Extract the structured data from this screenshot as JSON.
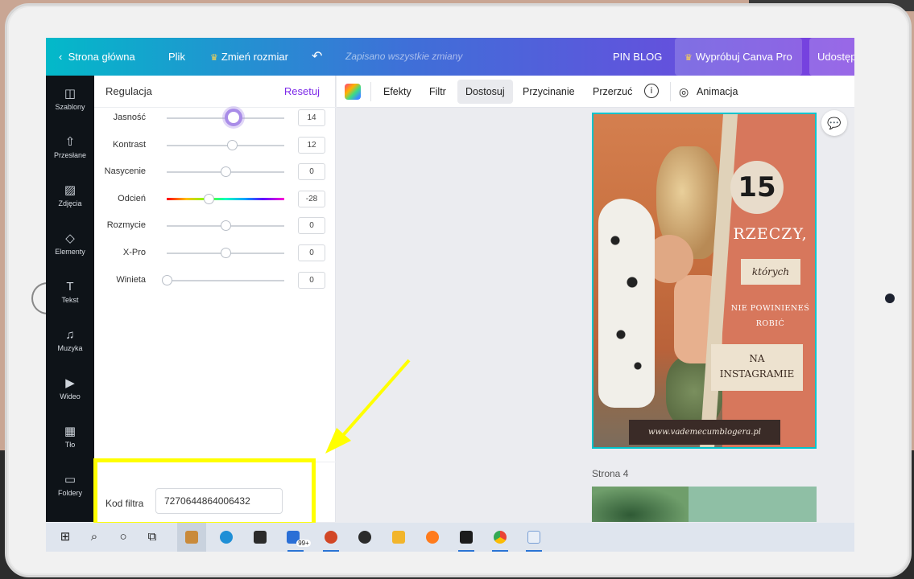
{
  "topbar": {
    "back": "Strona główna",
    "file": "Plik",
    "resize": "Zmień rozmiar",
    "undo_icon": "↶",
    "saved": "Zapisano wszystkie zmiany",
    "project": "PIN BLOG",
    "try_pro": "Wypróbuj Canva Pro",
    "share": "Udostęp",
    "crown_icon": "♛"
  },
  "sidebar": {
    "items": [
      {
        "label": "Szablony",
        "icon": "◫"
      },
      {
        "label": "Przesłane",
        "icon": "⇧"
      },
      {
        "label": "Zdjęcia",
        "icon": "▨"
      },
      {
        "label": "Elementy",
        "icon": "◇"
      },
      {
        "label": "Tekst",
        "icon": "T"
      },
      {
        "label": "Muzyka",
        "icon": "♫"
      },
      {
        "label": "Wideo",
        "icon": "▶"
      },
      {
        "label": "Tło",
        "icon": "▦"
      },
      {
        "label": "Foldery",
        "icon": "▭"
      }
    ]
  },
  "panel": {
    "title": "Regulacja",
    "reset": "Resetuj",
    "adjustments": [
      {
        "label": "Jasność",
        "value": "14",
        "level": 0.57
      },
      {
        "label": "Kontrast",
        "value": "12",
        "level": 0.56
      },
      {
        "label": "Nasycenie",
        "value": "0",
        "level": 0.5
      },
      {
        "label": "Odcień",
        "value": "-28",
        "level": 0.36
      },
      {
        "label": "Rozmycie",
        "value": "0",
        "level": 0.5
      },
      {
        "label": "X-Pro",
        "value": "0",
        "level": 0.5
      },
      {
        "label": "Winieta",
        "value": "0",
        "level": 0.0
      }
    ],
    "filter_label": "Kod filtra",
    "filter_code": "7270644864006432"
  },
  "context_toolbar": {
    "effects": "Efekty",
    "filter": "Filtr",
    "adjust": "Dostosuj",
    "crop": "Przycinanie",
    "flip": "Przerzuć",
    "info_icon": "i",
    "animation": "Animacja"
  },
  "design": {
    "number": "15",
    "headline": "RZECZY,",
    "which": "których",
    "line1": "NIE POWINIENEŚ",
    "line2": "ROBIĆ",
    "box_line1": "NA",
    "box_line2": "INSTAGRAMIE",
    "url": "www.vademecumblogera.pl"
  },
  "canvas": {
    "page_label": "Strona 4"
  },
  "taskbar": {
    "badge": "99+"
  }
}
